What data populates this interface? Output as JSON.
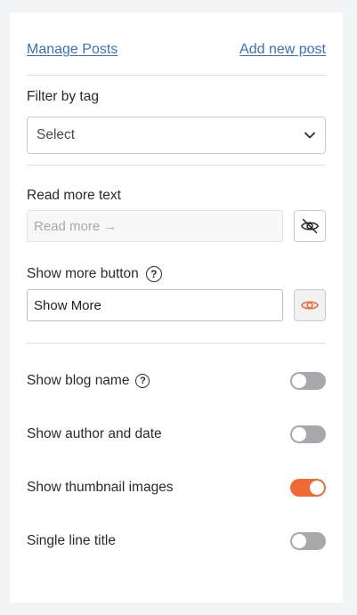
{
  "links": {
    "manage": "Manage Posts",
    "add": "Add new post"
  },
  "filter": {
    "label": "Filter by tag",
    "selected": "Select"
  },
  "read_more": {
    "label": "Read more text",
    "value": "Read more →",
    "visible": false
  },
  "show_more": {
    "label": "Show more button",
    "value": "Show More",
    "visible": true
  },
  "toggles": [
    {
      "label": "Show blog name",
      "on": false,
      "help": true
    },
    {
      "label": "Show author and date",
      "on": false,
      "help": false
    },
    {
      "label": "Show thumbnail images",
      "on": true,
      "help": false
    },
    {
      "label": "Single line title",
      "on": false,
      "help": false
    }
  ],
  "colors": {
    "accent": "#f06a35",
    "link": "#3b6fb6",
    "toggle_off": "#a8a8ac"
  },
  "icons": {
    "help": "?",
    "hidden": "eye-off-icon",
    "visible": "eye-icon"
  }
}
